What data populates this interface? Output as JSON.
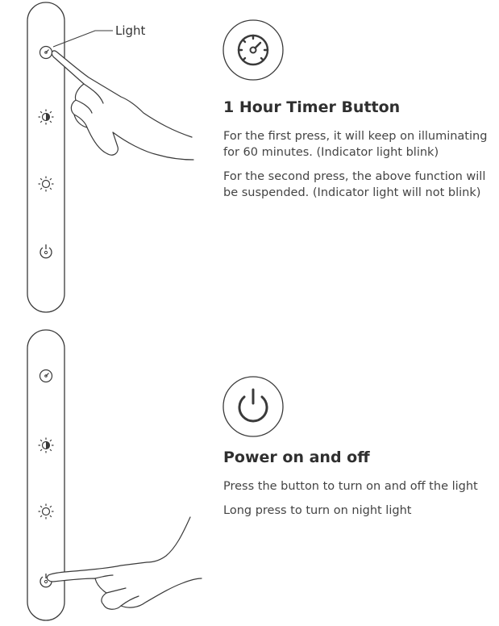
{
  "timer_section": {
    "callout_label": "Light",
    "title": "1 Hour Timer Button",
    "paragraphs": [
      "For the first press, it will keep on illuminating for 60 minutes. (Indicator light blink)",
      "For the second press, the above function will be suspended. (Indicator light will not blink)"
    ]
  },
  "power_section": {
    "title": "Power on and off",
    "paragraphs": [
      "Press the button to turn on and off the light",
      "Long press to turn on night light"
    ]
  },
  "icons": {
    "timer": "timer-icon",
    "brightness_dim": "brightness-half-icon",
    "brightness": "sun-icon",
    "power": "power-icon",
    "hand": "pointing-hand-icon"
  },
  "colors": {
    "line": "#3a3a3a",
    "text": "#444444",
    "heading": "#2f2f2f"
  }
}
